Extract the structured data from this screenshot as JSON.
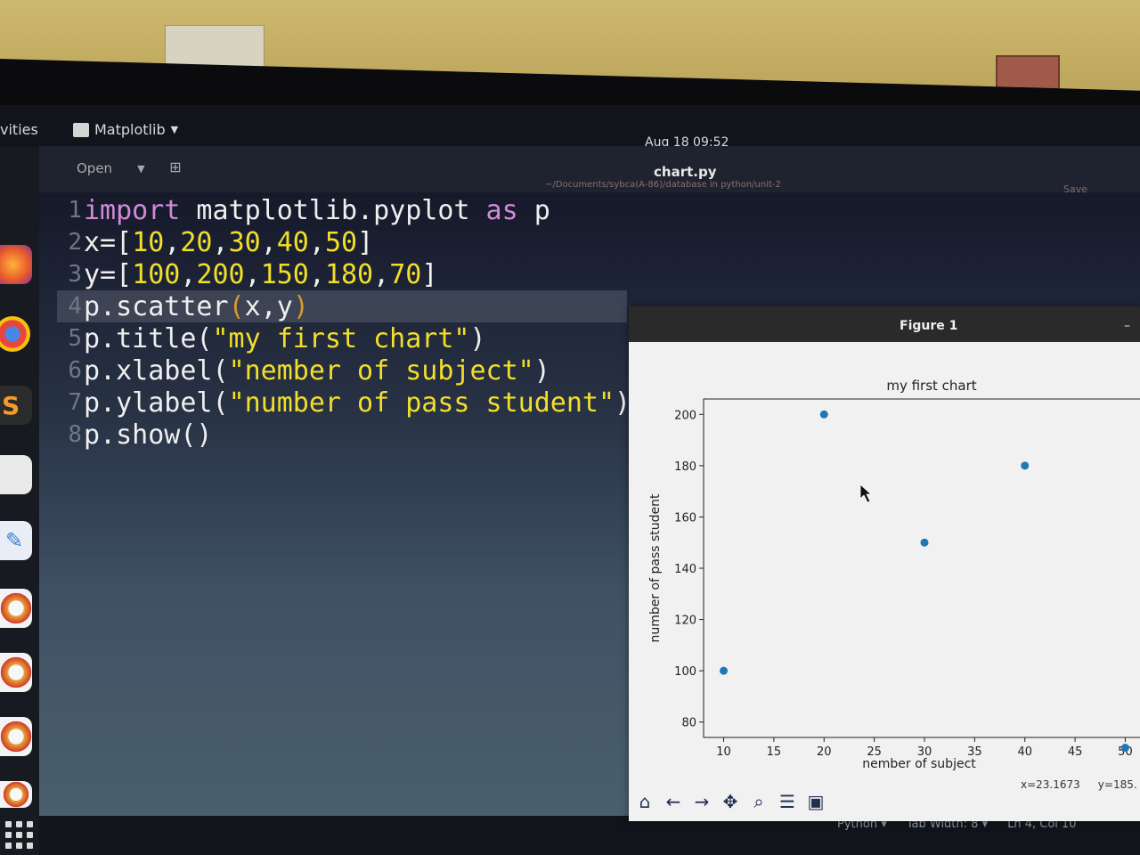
{
  "topbar": {
    "activities": "vities",
    "app_name": "Matplotlib",
    "clock": "Aug 18  09:52"
  },
  "editor": {
    "open_label": "Open",
    "filename": "chart.py",
    "filepath": "~/Documents/sybca(A-86)/database in python/unit-2",
    "save_label": "Save",
    "lines": [
      "import matplotlib.pyplot as p",
      "x=[10,20,30,40,50]",
      "y=[100,200,150,180,70]",
      "p.scatter(x,y)",
      "p.title(\"my first chart\")",
      "p.xlabel(\"nember of subject\")",
      "p.ylabel(\"number of pass student\")",
      "p.show()"
    ]
  },
  "statusbar": {
    "language": "Python",
    "tab_width": "Tab Width: 8",
    "position": "Ln 4, Col 10"
  },
  "figure": {
    "window_title": "Figure 1",
    "coords_x": "x=23.1673",
    "coords_y": "y=185."
  },
  "chart_data": {
    "type": "scatter",
    "title": "my first chart",
    "xlabel": "nember of subject",
    "ylabel": "number of pass student",
    "x": [
      10,
      20,
      30,
      40,
      50
    ],
    "y": [
      100,
      200,
      150,
      180,
      70
    ],
    "xticks": [
      10,
      15,
      20,
      25,
      30,
      35,
      40,
      45,
      50
    ],
    "yticks": [
      80,
      100,
      120,
      140,
      160,
      180,
      200
    ],
    "xlim": [
      8,
      52
    ],
    "ylim": [
      74,
      206
    ],
    "color": "#1f77b4",
    "grid": false
  },
  "colors": {
    "keyword": "#d18ad8",
    "number": "#f2df2a",
    "marker": "#1f77b4"
  }
}
